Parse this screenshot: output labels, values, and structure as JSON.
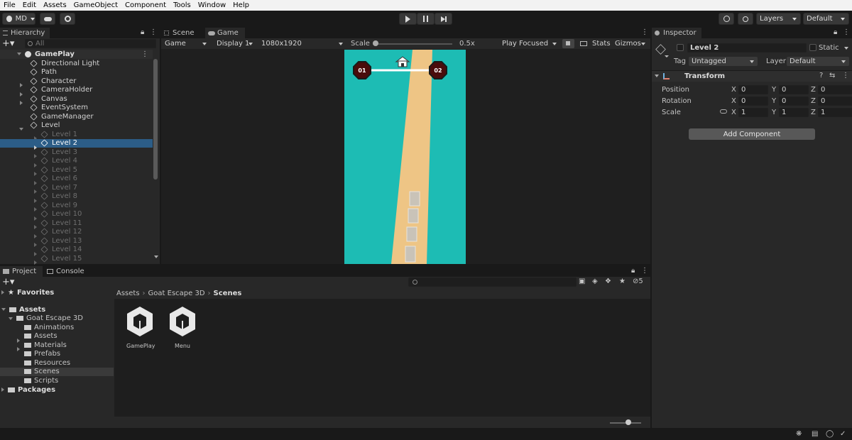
{
  "menu": [
    "File",
    "Edit",
    "Assets",
    "GameObject",
    "Component",
    "Tools",
    "Window",
    "Help"
  ],
  "toolbar": {
    "account": "MD",
    "layers": "Layers",
    "layout": "Default"
  },
  "hierarchy": {
    "tab": "Hierarchy",
    "search_placeholder": "All",
    "root": "GamePlay",
    "items": [
      "Directional Light",
      "Path",
      "Character",
      "CameraHolder",
      "Canvas",
      "EventSystem",
      "GameManager",
      "Level"
    ],
    "levels": [
      "Level 1",
      "Level 2",
      "Level 3",
      "Level 4",
      "Level 5",
      "Level 6",
      "Level 7",
      "Level 8",
      "Level 9",
      "Level 10",
      "Level 11",
      "Level 12",
      "Level 13",
      "Level 14",
      "Level 15"
    ]
  },
  "scene_tab": "Scene",
  "game": {
    "tab": "Game",
    "mode": "Game",
    "display": "Display 1",
    "resolution": "1080x1920",
    "scale_label": "Scale",
    "scale_value": "0.5x",
    "play_mode": "Play Focused",
    "stats": "Stats",
    "gizmos": "Gizmos",
    "level_from": "01",
    "level_to": "02"
  },
  "inspector": {
    "tab": "Inspector",
    "name": "Level 2",
    "static_label": "Static",
    "tag_label": "Tag",
    "tag": "Untagged",
    "layer_label": "Layer",
    "layer": "Default",
    "component": "Transform",
    "rows": [
      {
        "label": "Position",
        "x": "0",
        "y": "0",
        "z": "0"
      },
      {
        "label": "Rotation",
        "x": "0",
        "y": "0",
        "z": "0"
      },
      {
        "label": "Scale",
        "x": "1",
        "y": "1",
        "z": "1"
      }
    ],
    "axis": [
      "X",
      "Y",
      "Z"
    ],
    "add_component": "Add Component"
  },
  "project": {
    "tab": "Project",
    "console_tab": "Console",
    "hidden_count": "5",
    "favorites": "Favorites",
    "assets": "Assets",
    "folder": "Goat Escape 3D",
    "subfolders": [
      "Animations",
      "Assets",
      "Materials",
      "Prefabs",
      "Resources",
      "Scenes",
      "Scripts"
    ],
    "packages": "Packages",
    "breadcrumb": [
      "Assets",
      "Goat Escape 3D",
      "Scenes"
    ],
    "files": [
      "GamePlay",
      "Menu"
    ]
  },
  "colors": {
    "accent": "#2c5d87",
    "game_bg": "#1dbcb4",
    "path": "#eec585"
  }
}
